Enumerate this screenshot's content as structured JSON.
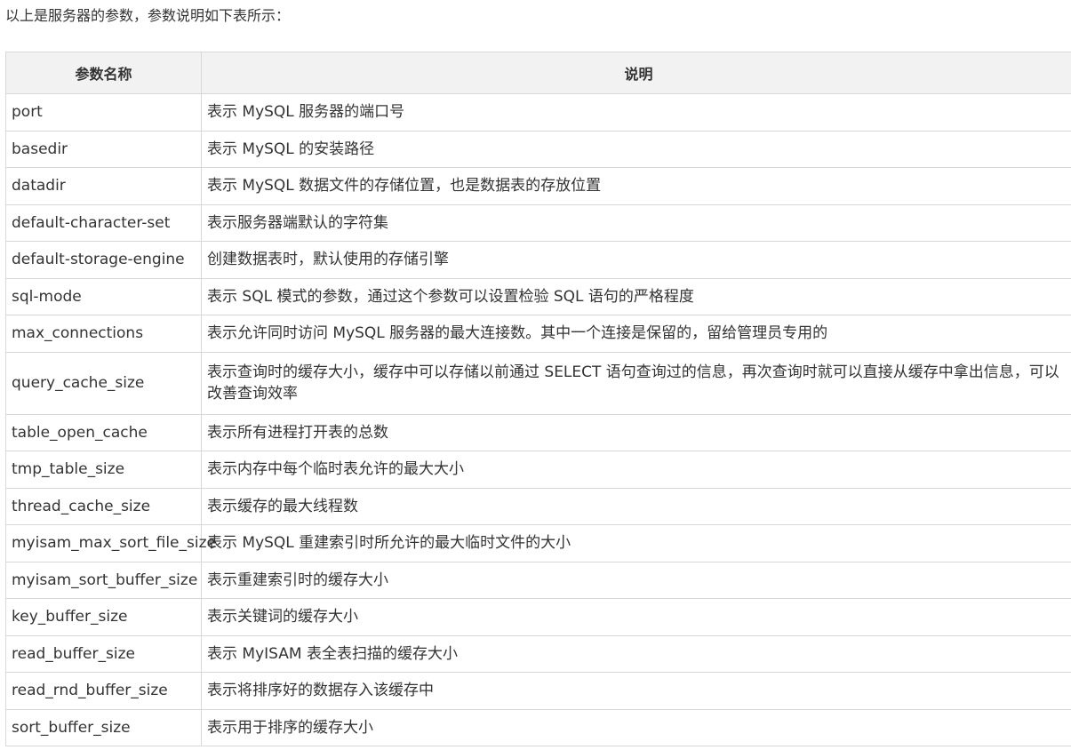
{
  "intro": "以上是服务器的参数，参数说明如下表所示：",
  "table": {
    "headers": [
      "参数名称",
      "说明"
    ],
    "rows": [
      {
        "name": "port",
        "desc": "表示 MySQL 服务器的端口号"
      },
      {
        "name": "basedir",
        "desc": "表示 MySQL 的安装路径"
      },
      {
        "name": "datadir",
        "desc": "表示 MySQL 数据文件的存储位置，也是数据表的存放位置"
      },
      {
        "name": "default-character-set",
        "desc": "表示服务器端默认的字符集"
      },
      {
        "name": "default-storage-engine",
        "desc": "创建数据表时，默认使用的存储引擎"
      },
      {
        "name": "sql-mode",
        "desc": "表示 SQL 模式的参数，通过这个参数可以设置检验 SQL 语句的严格程度"
      },
      {
        "name": "max_connections",
        "desc": "表示允许同时访问 MySQL 服务器的最大连接数。其中一个连接是保留的，留给管理员专用的"
      },
      {
        "name": "query_cache_size",
        "desc": "表示查询时的缓存大小，缓存中可以存储以前通过 SELECT 语句查询过的信息，再次查询时就可以直接从缓存中拿出信息，可以改善查询效率"
      },
      {
        "name": "table_open_cache",
        "desc": "表示所有进程打开表的总数"
      },
      {
        "name": "tmp_table_size",
        "desc": "表示内存中每个临时表允许的最大大小"
      },
      {
        "name": "thread_cache_size",
        "desc": "表示缓存的最大线程数"
      },
      {
        "name": "myisam_max_sort_file_size",
        "desc": "表示 MySQL 重建索引时所允许的最大临时文件的大小"
      },
      {
        "name": "myisam_sort_buffer_size",
        "desc": "表示重建索引时的缓存大小"
      },
      {
        "name": "key_buffer_size",
        "desc": "表示关键词的缓存大小"
      },
      {
        "name": "read_buffer_size",
        "desc": "表示 MyISAM 表全表扫描的缓存大小"
      },
      {
        "name": "read_rnd_buffer_size",
        "desc": "表示将排序好的数据存入该缓存中"
      },
      {
        "name": "sort_buffer_size",
        "desc": "表示用于排序的缓存大小"
      }
    ]
  }
}
